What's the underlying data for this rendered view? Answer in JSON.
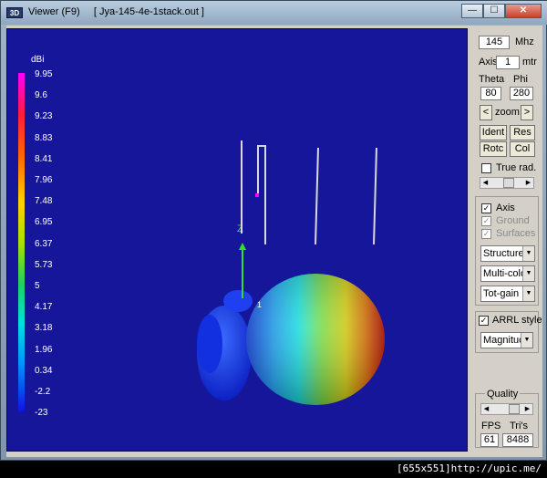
{
  "titlebar": {
    "icon_text": "3D",
    "title": "Viewer (F9)     [ Jya-145-4e-1stack.out ]",
    "minimize": "—",
    "maximize": "☐",
    "close": "✕"
  },
  "legend": {
    "unit": "dBi",
    "ticks": [
      "9.95",
      "9.6",
      "9.23",
      "8.83",
      "8.41",
      "7.96",
      "7.48",
      "6.95",
      "6.37",
      "5.73",
      "5",
      "4.17",
      "3.18",
      "1.96",
      "0.34",
      "-2.2",
      "-23"
    ]
  },
  "viewport": {
    "axis_label": "Z",
    "antenna_marker_label": "1"
  },
  "panel": {
    "freq_value": "145",
    "freq_unit": "Mhz",
    "axis_label": "Axis",
    "axis_value": "1",
    "axis_unit": "mtr",
    "theta_label": "Theta",
    "phi_label": "Phi",
    "theta_value": "80",
    "phi_value": "280",
    "zoom_left": "<",
    "zoom_label": "zoom",
    "zoom_right": ">",
    "ident": "Ident",
    "res": "Res",
    "rotc": "Rotc",
    "col": "Col",
    "true_rad": "True rad.",
    "axis_chk": "Axis",
    "ground_chk": "Ground",
    "surfaces_chk": "Surfaces",
    "select_structure": "Structure",
    "select_color": "Multi-colo",
    "select_gain": "Tot-gain",
    "arrl_style": "ARRL style",
    "select_mag": "Magnituc",
    "quality_label": "Quality",
    "fps_label": "FPS",
    "tris_label": "Tri's",
    "fps_value": "61",
    "tris_value": "8488"
  },
  "status": {
    "text": "[655x551]http://upic.me/"
  }
}
